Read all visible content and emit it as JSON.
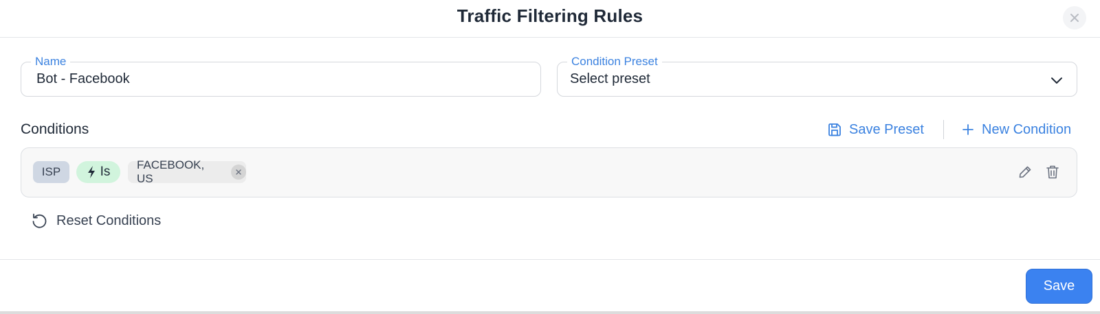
{
  "modal": {
    "title": "Traffic Filtering Rules",
    "close_icon": "close-icon"
  },
  "form": {
    "name": {
      "label": "Name",
      "value": "Bot - Facebook"
    },
    "preset": {
      "label": "Condition Preset",
      "value": "Select preset",
      "icon": "chevron-down-icon"
    }
  },
  "conditions": {
    "label": "Conditions",
    "save_preset_label": "Save Preset",
    "new_condition_label": "New Condition",
    "items": [
      {
        "field": "ISP",
        "operator": "Is",
        "operator_icon": "lightning-icon",
        "value": "FACEBOOK, US"
      }
    ],
    "reset_label": "Reset Conditions"
  },
  "footer": {
    "save_label": "Save"
  },
  "colors": {
    "accent": "#3b82e0",
    "primary_button": "#3b82f0",
    "operator_chip": "#d1f4dd",
    "field_chip": "#cfd7e3"
  }
}
